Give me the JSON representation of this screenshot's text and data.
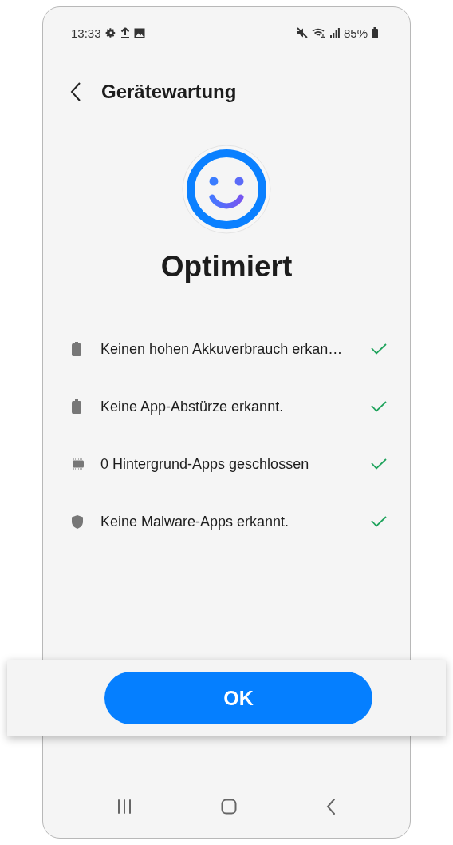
{
  "status_bar": {
    "time": "13:33",
    "battery": "85%"
  },
  "header": {
    "title": "Gerätewartung"
  },
  "status": {
    "title": "Optimiert"
  },
  "checks": [
    {
      "kind": "battery",
      "label": "Keinen hohen Akkuverbrauch erkan…",
      "checked": true
    },
    {
      "kind": "battery",
      "label": "Keine App-Abstürze erkannt.",
      "checked": true
    },
    {
      "kind": "memory",
      "label": "0 Hintergrund-Apps geschlossen",
      "checked": true
    },
    {
      "kind": "shield",
      "label": "Keine Malware-Apps erkannt.",
      "checked": true
    }
  ],
  "buttons": [
    "OK"
  ]
}
